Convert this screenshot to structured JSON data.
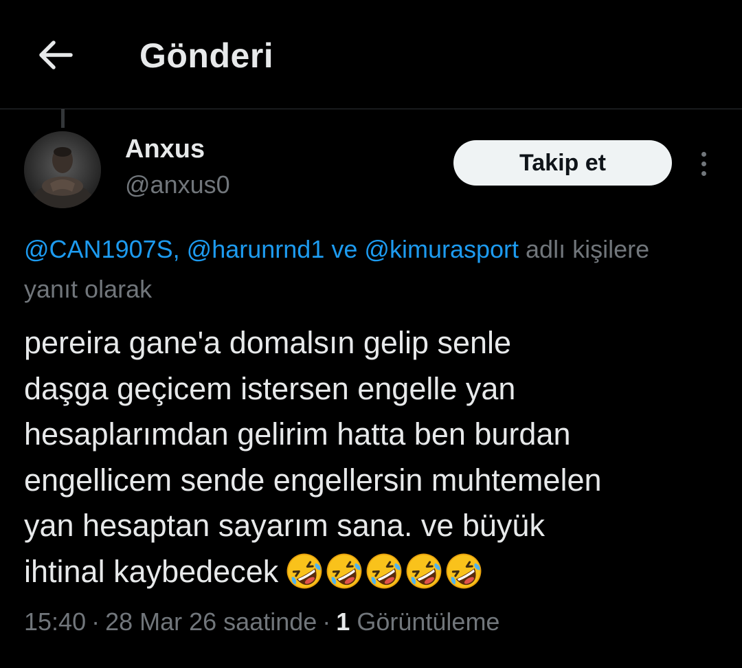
{
  "header": {
    "title": "Gönderi",
    "back_icon": "arrow-left-icon"
  },
  "author": {
    "name": "Anxus",
    "handle": "@anxus0"
  },
  "actions": {
    "follow_label": "Takip et",
    "more_icon": "more-vertical-icon"
  },
  "reply_context": {
    "mention_1": "@CAN1907S,",
    "mention_2": "@harunrnd1",
    "connector": "ve",
    "mention_3": "@kimurasport",
    "suffix_1": "adlı kişilere",
    "suffix_2": "yanıt olarak"
  },
  "tweet": {
    "lines": [
      "pereira gane'a domalsın gelip senle",
      "daşga geçicem istersen engelle yan",
      "hesaplarımdan gelirim hatta ben burdan",
      "engellicem sende engellersin muhtemelen",
      "yan hesaptan sayarım sana. ve büyük",
      "ihtinal kaybedecek"
    ],
    "emoji": "🤣🤣🤣🤣🤣"
  },
  "meta": {
    "time": "15:40",
    "date": "28 Mar 26 saatinde",
    "separator": "·",
    "views_count": "1",
    "views_label": "Görüntüleme"
  },
  "colors": {
    "background": "#000000",
    "text_primary": "#e7e9ea",
    "text_secondary": "#71767b",
    "link": "#1d9bf0",
    "button_bg": "#eff3f4"
  }
}
